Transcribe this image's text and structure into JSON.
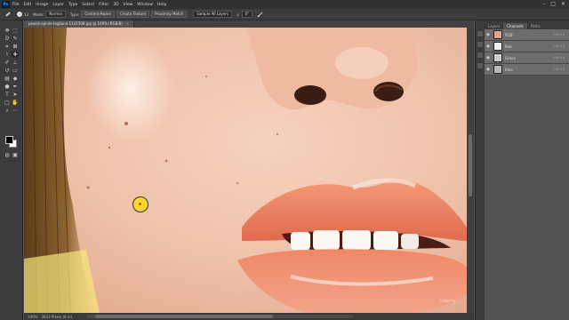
{
  "menubar": {
    "logo": "Ps",
    "items": [
      "File",
      "Edit",
      "Image",
      "Layer",
      "Type",
      "Select",
      "Filter",
      "3D",
      "View",
      "Window",
      "Help"
    ],
    "window_controls": [
      "–",
      "□",
      "✕"
    ]
  },
  "options_bar": {
    "tool_icon": "spot-healing-brush-icon",
    "brush_size": "13",
    "mode_label": "Mode:",
    "mode_value": "Normal",
    "type_label": "Type:",
    "type_options": [
      "Content-Aware",
      "Create Texture",
      "Proximity Match"
    ],
    "sample_all_layers": "Sample All Layers",
    "angle": "0°"
  },
  "document": {
    "tab_title": "pexels-aphile-tagliano-1141508.jpg @ 100% (RGB/8)",
    "close": "×"
  },
  "tools": [
    "move",
    "marquee",
    "lasso",
    "quick-select",
    "crop",
    "frame",
    "eyedropper",
    "spot-healing",
    "brush",
    "clone-stamp",
    "history-brush",
    "eraser",
    "gradient",
    "blur",
    "dodge",
    "pen",
    "type",
    "path-select",
    "rectangle",
    "hand",
    "zoom"
  ],
  "channels_panel": {
    "tabs": [
      "Layers",
      "Channels",
      "Paths"
    ],
    "active_tab": "Channels",
    "rows": [
      {
        "name": "RGB",
        "shortcut": "Ctrl+2",
        "thumb": "#e6a48a"
      },
      {
        "name": "Red",
        "shortcut": "Ctrl+3",
        "thumb": "#f0f0f0"
      },
      {
        "name": "Green",
        "shortcut": "Ctrl+4",
        "thumb": "#d0d0d0"
      },
      {
        "name": "Blue",
        "shortcut": "Ctrl+5",
        "thumb": "#b8b8b8"
      }
    ]
  },
  "status": {
    "zoom": "100%",
    "info": "3633 Pixels (8 in)"
  },
  "watermark": "Udemy",
  "colors": {
    "foreground": "#000000",
    "background": "#ffffff",
    "cursor": "#ffd200"
  }
}
